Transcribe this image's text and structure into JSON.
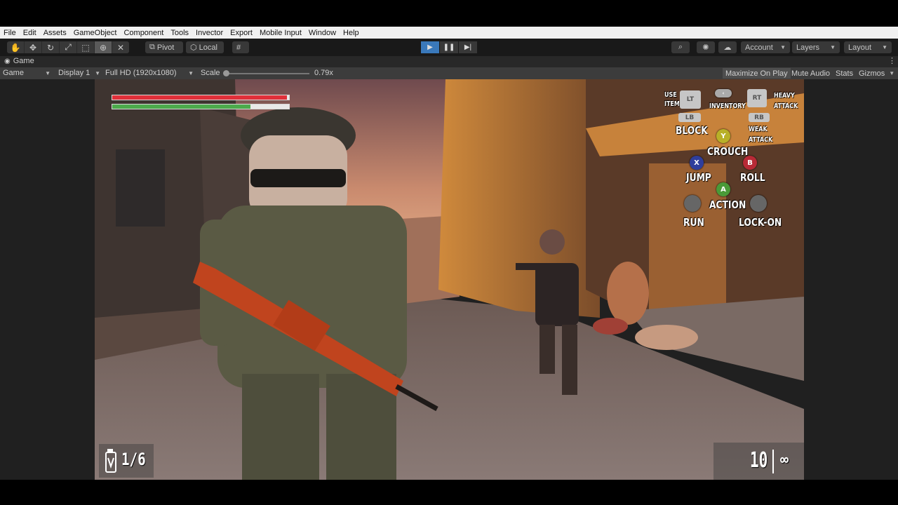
{
  "menu": [
    "File",
    "Edit",
    "Assets",
    "GameObject",
    "Component",
    "Tools",
    "Invector",
    "Export",
    "Mobile Input",
    "Window",
    "Help"
  ],
  "toolbar": {
    "pivot_label": "Pivot",
    "space_label": "Local",
    "account_label": "Account",
    "layers_label": "Layers",
    "layout_label": "Layout"
  },
  "game_tab": {
    "tab_label": "Game",
    "view_label": "Game",
    "display_label": "Display 1",
    "resolution_label": "Full HD (1920x1080)",
    "scale_label": "Scale",
    "scale_value": "0.79x",
    "maximize_label": "Maximize On Play",
    "mute_label": "Mute Audio",
    "stats_label": "Stats",
    "gizmos_label": "Gizmos"
  },
  "hud": {
    "health_fraction": 0.99,
    "stamina_fraction": 0.78,
    "health_color": "#e0303a",
    "stamina_color": "#4caa4c",
    "grenade_count": "1/6",
    "ammo_count": "10",
    "ammo_reserve": "∞"
  },
  "controls": {
    "use_item_line1": "USE",
    "use_item_line2": "ITEM",
    "lt": "LT",
    "lb": "LB",
    "block": "BLOCK",
    "inventory": "INVENTORY",
    "rt": "RT",
    "rb": "RB",
    "heavy_line1": "HEAVY",
    "heavy_line2": "ATTACK",
    "weak_line1": "WEAK",
    "weak_line2": "ATTACK",
    "y": "Y",
    "crouch": "CROUCH",
    "x": "X",
    "jump": "JUMP",
    "b": "B",
    "roll": "ROLL",
    "a": "A",
    "action": "ACTION",
    "run": "RUN",
    "lockon": "LOCK-ON"
  }
}
